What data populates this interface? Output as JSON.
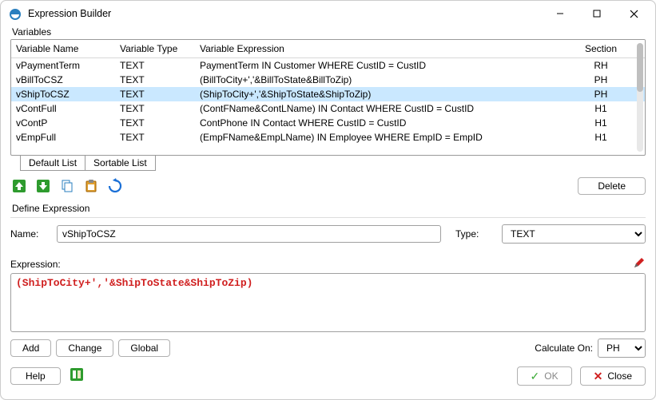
{
  "window": {
    "title": "Expression Builder"
  },
  "labels": {
    "variables": "Variables",
    "define_expression": "Define Expression",
    "name": "Name:",
    "type": "Type:",
    "expression": "Expression:",
    "calculate_on": "Calculate On:"
  },
  "tabs": {
    "default": "Default List",
    "sortable": "Sortable List"
  },
  "grid": {
    "headers": {
      "name": "Variable Name",
      "type": "Variable Type",
      "expression": "Variable Expression",
      "section": "Section"
    },
    "rows": [
      {
        "name": "vPaymentTerm",
        "type": "TEXT",
        "expression": "PaymentTerm  IN Customer WHERE CustID = CustID",
        "section": "RH",
        "selected": false
      },
      {
        "name": "vBillToCSZ",
        "type": "TEXT",
        "expression": "(BillToCity+','&BillToState&BillToZip)",
        "section": "PH",
        "selected": false
      },
      {
        "name": "vShipToCSZ",
        "type": "TEXT",
        "expression": "(ShipToCity+','&ShipToState&ShipToZip)",
        "section": "PH",
        "selected": true
      },
      {
        "name": "vContFull",
        "type": "TEXT",
        "expression": "(ContFName&ContLName) IN Contact WHERE CustID = CustID",
        "section": "H1",
        "selected": false
      },
      {
        "name": "vContP",
        "type": "TEXT",
        "expression": "ContPhone IN Contact WHERE CustID = CustID",
        "section": "H1",
        "selected": false
      },
      {
        "name": "vEmpFull",
        "type": "TEXT",
        "expression": "(EmpFName&EmpLName) IN Employee WHERE EmpID = EmpID",
        "section": "H1",
        "selected": false
      }
    ]
  },
  "buttons": {
    "delete": "Delete",
    "add": "Add",
    "change": "Change",
    "global": "Global",
    "help": "Help",
    "ok": "OK",
    "close": "Close"
  },
  "form": {
    "name": "vShipToCSZ",
    "type": "TEXT",
    "expression": "(ShipToCity+','&ShipToState&ShipToZip)",
    "calculate_on": "PH"
  }
}
